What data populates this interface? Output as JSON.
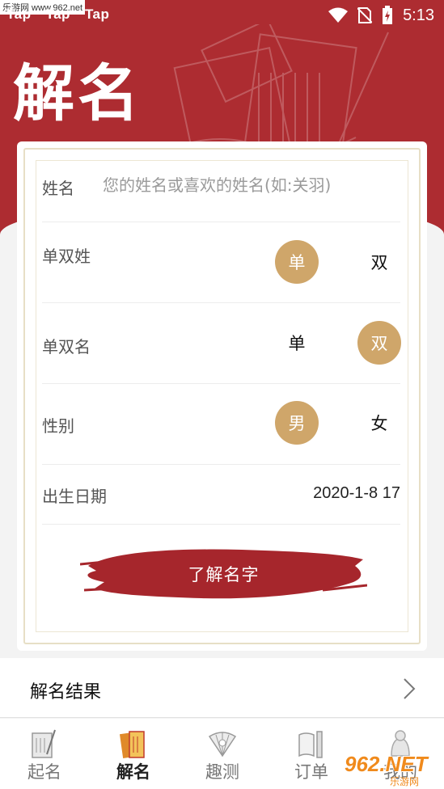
{
  "status_bar": {
    "left_apps": [
      "Tap",
      "Tap",
      "Tap"
    ],
    "time": "5:13"
  },
  "watermark": {
    "site": "乐游网 www.962.net",
    "logo_text": "962.NET",
    "logo_sub": "乐游网"
  },
  "header": {
    "title": "解名"
  },
  "form": {
    "name_label": "姓名",
    "name_placeholder": "您的姓名或喜欢的姓名(如:关羽)",
    "name_value": "",
    "surname_type": {
      "label": "单双姓",
      "options": [
        "单",
        "双"
      ],
      "selected": "单"
    },
    "given_type": {
      "label": "单双名",
      "options": [
        "单",
        "双"
      ],
      "selected": "双"
    },
    "gender": {
      "label": "性别",
      "options": [
        "男",
        "女"
      ],
      "selected": "男"
    },
    "birth": {
      "label": "出生日期",
      "value": "2020-1-8 17"
    },
    "submit_label": "了解名字"
  },
  "result": {
    "label": "解名结果"
  },
  "bottom_nav": {
    "items": [
      {
        "label": "起名",
        "icon": "naming-scroll-icon",
        "active": false
      },
      {
        "label": "解名",
        "icon": "interpret-book-icon",
        "active": true
      },
      {
        "label": "趣测",
        "icon": "fan-icon",
        "active": false
      },
      {
        "label": "订单",
        "icon": "order-scroll-icon",
        "active": false
      },
      {
        "label": "我的",
        "icon": "profile-icon",
        "active": false
      }
    ]
  },
  "colors": {
    "brand_red": "#ad2c31",
    "accent_gold": "#cfa66a",
    "frame_gold": "#e7dfc6"
  }
}
